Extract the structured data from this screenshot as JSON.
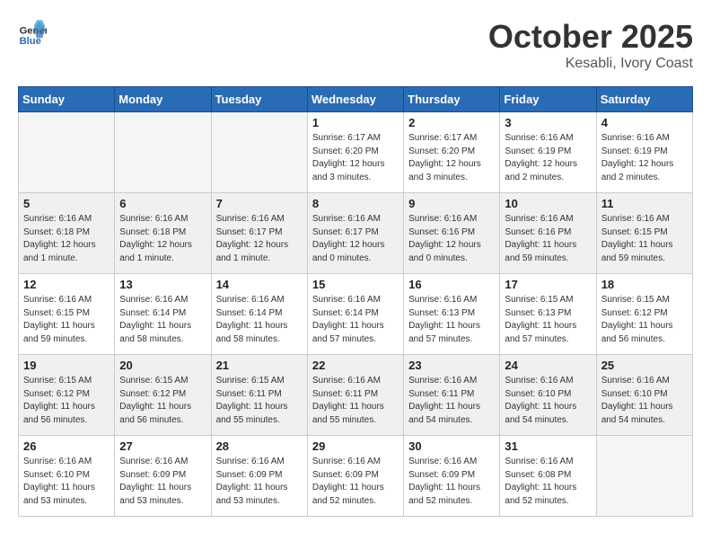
{
  "header": {
    "logo_general": "General",
    "logo_blue": "Blue",
    "month": "October 2025",
    "location": "Kesabli, Ivory Coast"
  },
  "weekdays": [
    "Sunday",
    "Monday",
    "Tuesday",
    "Wednesday",
    "Thursday",
    "Friday",
    "Saturday"
  ],
  "weeks": [
    [
      {
        "day": "",
        "info": ""
      },
      {
        "day": "",
        "info": ""
      },
      {
        "day": "",
        "info": ""
      },
      {
        "day": "1",
        "info": "Sunrise: 6:17 AM\nSunset: 6:20 PM\nDaylight: 12 hours and 3 minutes."
      },
      {
        "day": "2",
        "info": "Sunrise: 6:17 AM\nSunset: 6:20 PM\nDaylight: 12 hours and 3 minutes."
      },
      {
        "day": "3",
        "info": "Sunrise: 6:16 AM\nSunset: 6:19 PM\nDaylight: 12 hours and 2 minutes."
      },
      {
        "day": "4",
        "info": "Sunrise: 6:16 AM\nSunset: 6:19 PM\nDaylight: 12 hours and 2 minutes."
      }
    ],
    [
      {
        "day": "5",
        "info": "Sunrise: 6:16 AM\nSunset: 6:18 PM\nDaylight: 12 hours and 1 minute."
      },
      {
        "day": "6",
        "info": "Sunrise: 6:16 AM\nSunset: 6:18 PM\nDaylight: 12 hours and 1 minute."
      },
      {
        "day": "7",
        "info": "Sunrise: 6:16 AM\nSunset: 6:17 PM\nDaylight: 12 hours and 1 minute."
      },
      {
        "day": "8",
        "info": "Sunrise: 6:16 AM\nSunset: 6:17 PM\nDaylight: 12 hours and 0 minutes."
      },
      {
        "day": "9",
        "info": "Sunrise: 6:16 AM\nSunset: 6:16 PM\nDaylight: 12 hours and 0 minutes."
      },
      {
        "day": "10",
        "info": "Sunrise: 6:16 AM\nSunset: 6:16 PM\nDaylight: 11 hours and 59 minutes."
      },
      {
        "day": "11",
        "info": "Sunrise: 6:16 AM\nSunset: 6:15 PM\nDaylight: 11 hours and 59 minutes."
      }
    ],
    [
      {
        "day": "12",
        "info": "Sunrise: 6:16 AM\nSunset: 6:15 PM\nDaylight: 11 hours and 59 minutes."
      },
      {
        "day": "13",
        "info": "Sunrise: 6:16 AM\nSunset: 6:14 PM\nDaylight: 11 hours and 58 minutes."
      },
      {
        "day": "14",
        "info": "Sunrise: 6:16 AM\nSunset: 6:14 PM\nDaylight: 11 hours and 58 minutes."
      },
      {
        "day": "15",
        "info": "Sunrise: 6:16 AM\nSunset: 6:14 PM\nDaylight: 11 hours and 57 minutes."
      },
      {
        "day": "16",
        "info": "Sunrise: 6:16 AM\nSunset: 6:13 PM\nDaylight: 11 hours and 57 minutes."
      },
      {
        "day": "17",
        "info": "Sunrise: 6:15 AM\nSunset: 6:13 PM\nDaylight: 11 hours and 57 minutes."
      },
      {
        "day": "18",
        "info": "Sunrise: 6:15 AM\nSunset: 6:12 PM\nDaylight: 11 hours and 56 minutes."
      }
    ],
    [
      {
        "day": "19",
        "info": "Sunrise: 6:15 AM\nSunset: 6:12 PM\nDaylight: 11 hours and 56 minutes."
      },
      {
        "day": "20",
        "info": "Sunrise: 6:15 AM\nSunset: 6:12 PM\nDaylight: 11 hours and 56 minutes."
      },
      {
        "day": "21",
        "info": "Sunrise: 6:15 AM\nSunset: 6:11 PM\nDaylight: 11 hours and 55 minutes."
      },
      {
        "day": "22",
        "info": "Sunrise: 6:16 AM\nSunset: 6:11 PM\nDaylight: 11 hours and 55 minutes."
      },
      {
        "day": "23",
        "info": "Sunrise: 6:16 AM\nSunset: 6:11 PM\nDaylight: 11 hours and 54 minutes."
      },
      {
        "day": "24",
        "info": "Sunrise: 6:16 AM\nSunset: 6:10 PM\nDaylight: 11 hours and 54 minutes."
      },
      {
        "day": "25",
        "info": "Sunrise: 6:16 AM\nSunset: 6:10 PM\nDaylight: 11 hours and 54 minutes."
      }
    ],
    [
      {
        "day": "26",
        "info": "Sunrise: 6:16 AM\nSunset: 6:10 PM\nDaylight: 11 hours and 53 minutes."
      },
      {
        "day": "27",
        "info": "Sunrise: 6:16 AM\nSunset: 6:09 PM\nDaylight: 11 hours and 53 minutes."
      },
      {
        "day": "28",
        "info": "Sunrise: 6:16 AM\nSunset: 6:09 PM\nDaylight: 11 hours and 53 minutes."
      },
      {
        "day": "29",
        "info": "Sunrise: 6:16 AM\nSunset: 6:09 PM\nDaylight: 11 hours and 52 minutes."
      },
      {
        "day": "30",
        "info": "Sunrise: 6:16 AM\nSunset: 6:09 PM\nDaylight: 11 hours and 52 minutes."
      },
      {
        "day": "31",
        "info": "Sunrise: 6:16 AM\nSunset: 6:08 PM\nDaylight: 11 hours and 52 minutes."
      },
      {
        "day": "",
        "info": ""
      }
    ]
  ]
}
